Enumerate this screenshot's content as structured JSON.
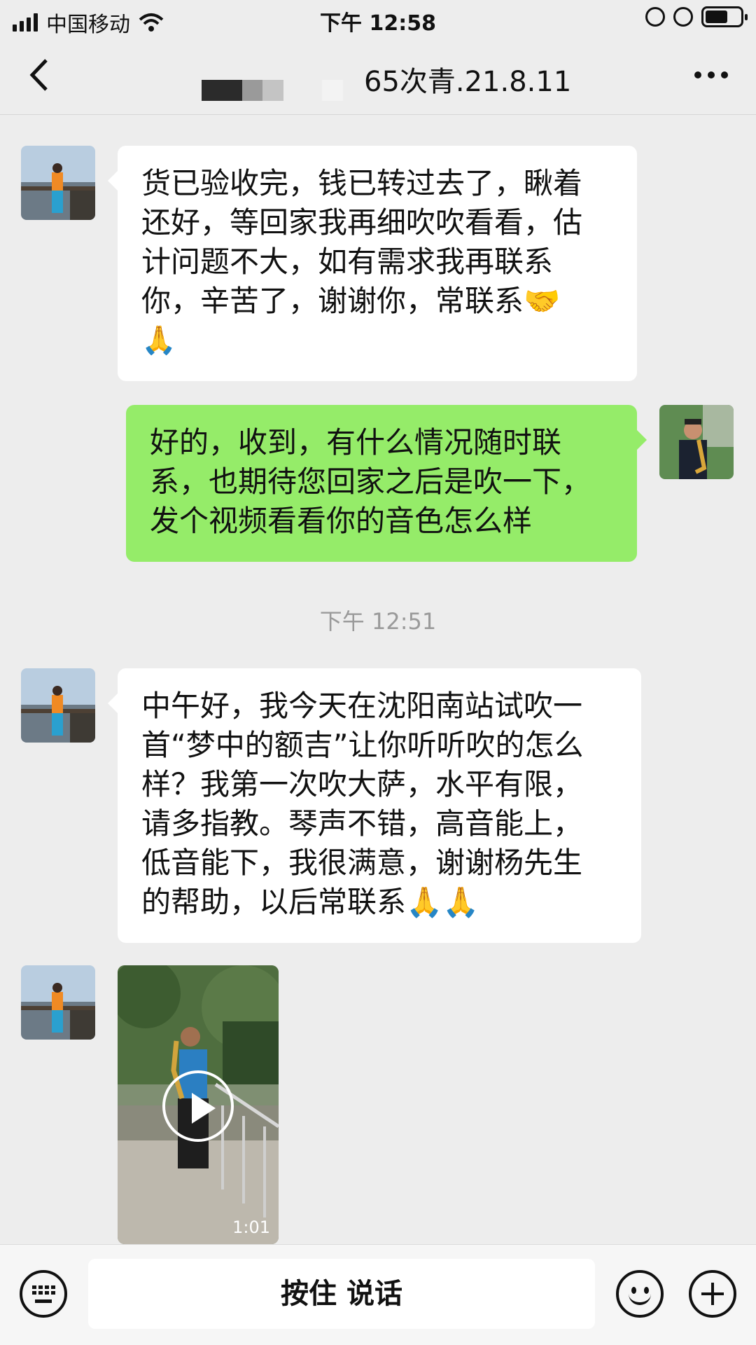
{
  "status_bar": {
    "carrier": "中国移动",
    "time": "下午 12:58"
  },
  "nav": {
    "title_visible": "65次青.21.8.11"
  },
  "messages": [
    {
      "side": "left",
      "lines": [
        "货已验收完，钱已转过去了，瞅着",
        "还好，等回家我再细吹吹看看，估",
        "计问题不大，如有需求我再联系",
        "你，辛苦了，谢谢你，常联系🤝",
        "🙏"
      ]
    },
    {
      "side": "right",
      "lines": [
        "好的，收到，有什么情况随时联",
        "系，也期待您回家之后是吹一下，",
        "发个视频看看你的音色怎么样"
      ]
    },
    {
      "side": "left",
      "lines": [
        "中午好，我今天在沈阳南站试吹一",
        "首“梦中的额吉”让你听听吹的怎么",
        "样？我第一次吹大萨，水平有限，",
        "请多指教。琴声不错，高音能上，",
        "低音能下，我很满意，谢谢杨先生",
        "的帮助，以后常联系🙏🙏"
      ]
    }
  ],
  "timestamp": "下午 12:51",
  "video": {
    "duration": "1:01"
  },
  "input_bar": {
    "talk_label": "按住 说话",
    "keyboard_icon": "keyboard-icon",
    "emoji_icon": "smiley-icon",
    "plus_icon": "plus-icon"
  },
  "colors": {
    "background": "#ededed",
    "bubble_left": "#ffffff",
    "bubble_right": "#95ec69"
  }
}
